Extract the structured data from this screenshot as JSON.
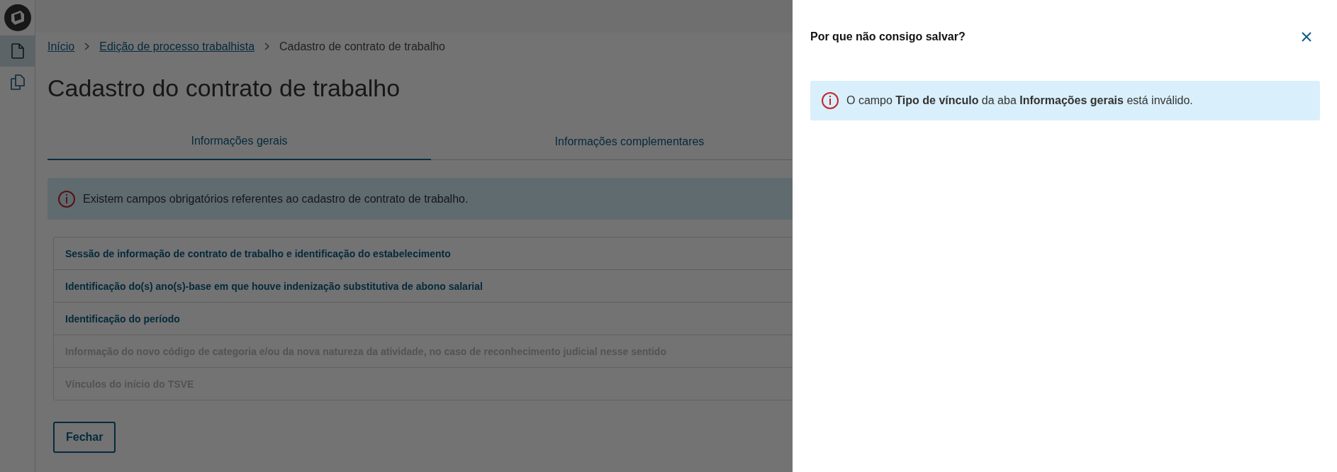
{
  "sidebar": {
    "items": [
      {
        "kind": "document",
        "selected": true
      },
      {
        "kind": "copy",
        "selected": false
      }
    ]
  },
  "breadcrumb": [
    {
      "label": "Início",
      "kind": "link"
    },
    {
      "label": "Edição de processo trabalhista",
      "kind": "link"
    },
    {
      "label": "Cadastro de contrato de trabalho",
      "kind": "current"
    }
  ],
  "page_title": "Cadastro do contrato de trabalho",
  "tabs": [
    {
      "label": "Informações gerais",
      "selected": true
    },
    {
      "label": "Informações complementares",
      "selected": false
    }
  ],
  "alert": {
    "message": "Existem campos obrigatórios referentes ao cadastro de contrato de trabalho."
  },
  "sections": [
    {
      "label": "Sessão de informação de contrato de trabalho e identificação do estabelecimento",
      "disabled": false
    },
    {
      "label": "Identificação do(s) ano(s)-base em que houve indenização substitutiva de abono salarial",
      "disabled": false
    },
    {
      "label": "Identificação do período",
      "disabled": false
    },
    {
      "label": "Informação do novo código de categoria e/ou da nova natureza da atividade, no caso de reconhecimento judicial nesse sentido",
      "disabled": true
    },
    {
      "label": "Vínculos do início do TSVE",
      "disabled": true
    }
  ],
  "buttons": [
    "Fechar"
  ],
  "help_panel": {
    "title": "Por que não consigo salvar?",
    "alert": {
      "message": "O campo **Tipo de vínculo** da aba **Informações gerais** está inválido."
    }
  }
}
